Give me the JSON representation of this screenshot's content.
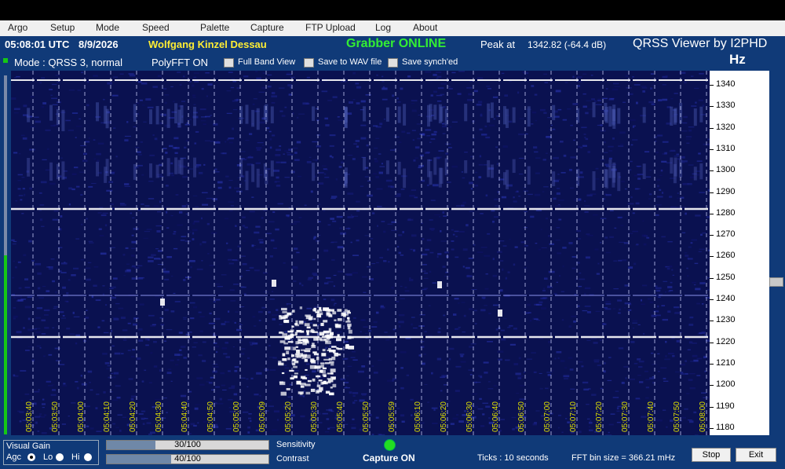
{
  "menu": [
    "Argo",
    "Setup",
    "Mode",
    "Speed",
    "Palette",
    "Capture",
    "FTP Upload",
    "Log",
    "About"
  ],
  "header": {
    "time": "05:08:01 UTC",
    "date": "8/9/2026",
    "station": "Wolfgang Kinzel Dessau",
    "grabber_status": "Grabber ONLINE",
    "peak_label": "Peak at",
    "peak_value": "1342.82 (-64.4 dB)",
    "app_title": "QRSS Viewer by I2PHD",
    "unit": "Hz",
    "mode": "Mode : QRSS 3, normal",
    "polyfft": "PolyFFT ON",
    "checkboxes": [
      "Full Band View",
      "Save to WAV file",
      "Save synch'ed"
    ]
  },
  "y_axis": {
    "labels": [
      "1340",
      "1330",
      "1320",
      "1310",
      "1300",
      "1290",
      "1280",
      "1270",
      "1260",
      "1250",
      "1240",
      "1230",
      "1220",
      "1210",
      "1200",
      "1190",
      "1180"
    ]
  },
  "time_labels": [
    "05:03:40",
    "05:03:50",
    "05:04:00",
    "05:04:10",
    "05:04:20",
    "05:04:30",
    "05:04:40",
    "05:04:50",
    "05:05:00",
    "05:05:09",
    "05:05:20",
    "05:05:30",
    "05:05:40",
    "05:05:50",
    "05:05:59",
    "05:06:10",
    "05:06:20",
    "05:06:30",
    "05:06:40",
    "05:06:50",
    "05:07:00",
    "05:07:10",
    "05:07:20",
    "05:07:30",
    "05:07:40",
    "05:07:50",
    "05:08:00"
  ],
  "bottom": {
    "visual_gain": "Visual Gain",
    "agc": "Agc",
    "lo": "Lo",
    "hi": "Hi",
    "sensitivity_value": "30/100",
    "sensitivity_level": 0.3,
    "sensitivity_label": "Sensitivity",
    "contrast_value": "40/100",
    "contrast_level": 0.4,
    "contrast_label": "Contrast",
    "capture_status": "Capture ON",
    "ticks": "Ticks  :  10 seconds",
    "fft_bin": "FFT bin size = 366.21 mHz",
    "stop_label": "Stop",
    "exit_label": "Exit"
  },
  "colors": {
    "panel": "#103a78",
    "waterfall_bg": "#0a1150",
    "station": "#ffee33",
    "grabber": "#33ee33",
    "time_labels": "#e0e000",
    "capture_led": "#22dd22"
  }
}
